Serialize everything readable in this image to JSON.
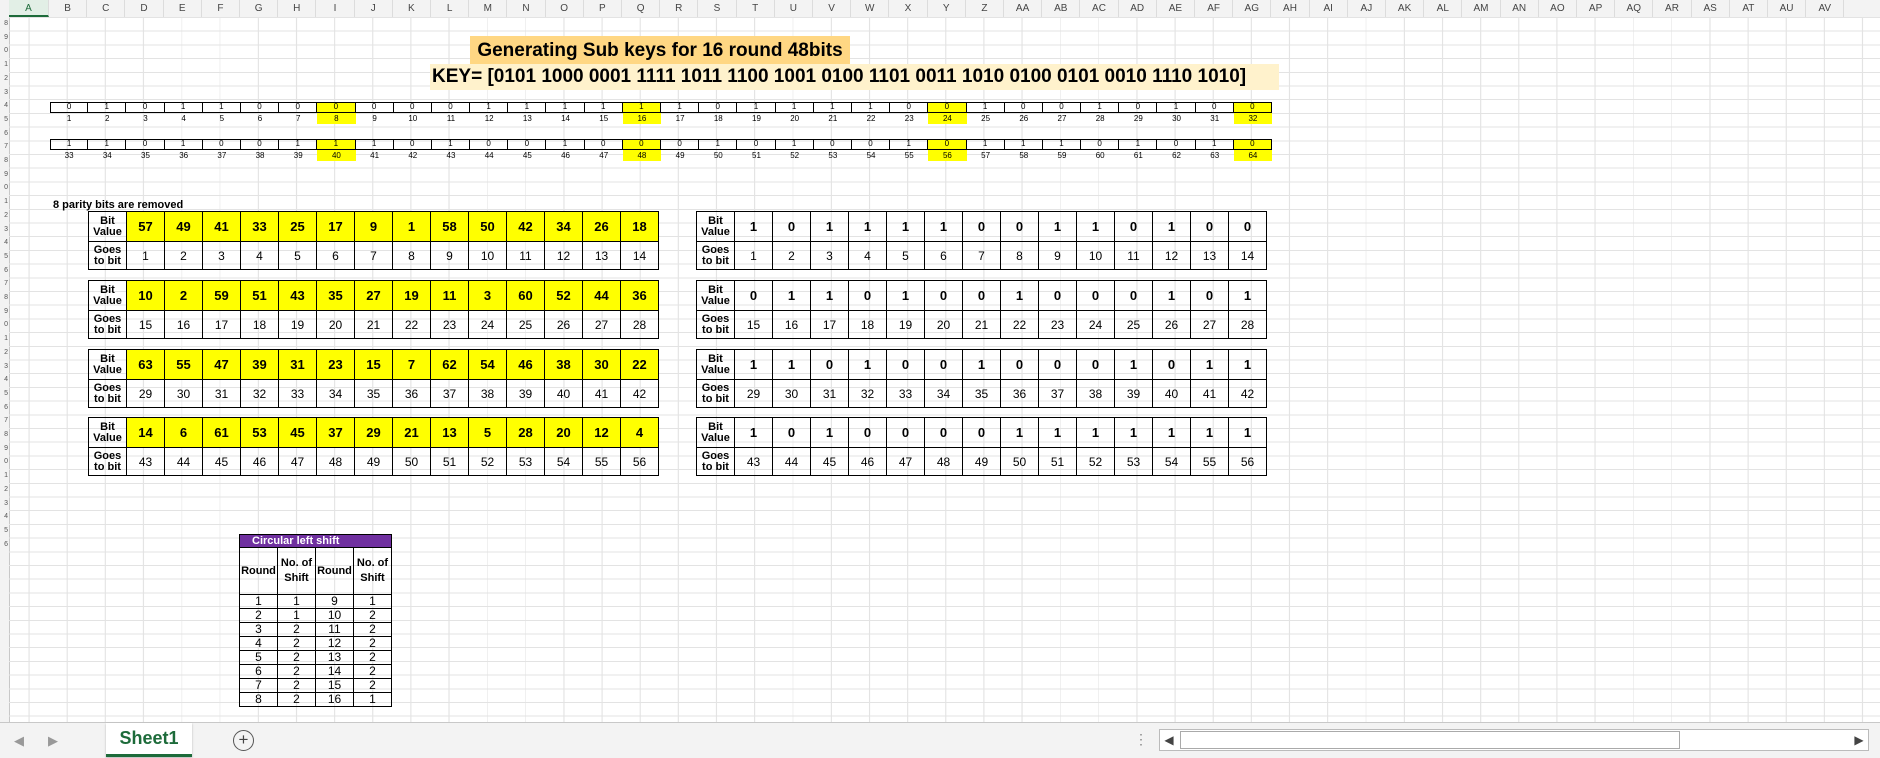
{
  "columns": [
    "A",
    "B",
    "C",
    "D",
    "E",
    "F",
    "G",
    "H",
    "I",
    "J",
    "K",
    "L",
    "M",
    "N",
    "O",
    "P",
    "Q",
    "R",
    "S",
    "T",
    "U",
    "V",
    "W",
    "X",
    "Y",
    "Z",
    "AA",
    "AB",
    "AC",
    "AD",
    "AE",
    "AF",
    "AG",
    "AH",
    "AI",
    "AJ",
    "AK",
    "AL",
    "AM",
    "AN",
    "AO",
    "AP",
    "AQ",
    "AR",
    "AS",
    "AT",
    "AU",
    "AV"
  ],
  "selected_column": "A",
  "row_numbers": [
    "8",
    "9",
    "0",
    "1",
    "2",
    "3",
    "4",
    "5",
    "6",
    "7",
    "8",
    "9",
    "0",
    "1",
    "2",
    "3",
    "4",
    "5",
    "6",
    "7",
    "8",
    "9",
    "0",
    "1",
    "2",
    "3",
    "4",
    "5",
    "6",
    "7",
    "8",
    "9",
    "0",
    "1",
    "2",
    "3",
    "4",
    "5",
    "6"
  ],
  "title": "Generating Sub keys for 16  round  48bits",
  "key_line": "KEY= [0101 1000 0001 1111 1011 1100 1001 0100 1101 0011 1010 0100 0101 0010 1110 1010]",
  "key_bits_row1": [
    "0",
    "1",
    "0",
    "1",
    "1",
    "0",
    "0",
    "0",
    "0",
    "0",
    "0",
    "1",
    "1",
    "1",
    "1",
    "1",
    "1",
    "0",
    "1",
    "1",
    "1",
    "1",
    "0",
    "0",
    "1",
    "0",
    "0",
    "1",
    "0",
    "1",
    "0",
    "0"
  ],
  "key_index_row1": [
    "1",
    "2",
    "3",
    "4",
    "5",
    "6",
    "7",
    "8",
    "9",
    "10",
    "11",
    "12",
    "13",
    "14",
    "15",
    "16",
    "17",
    "18",
    "19",
    "20",
    "21",
    "22",
    "23",
    "24",
    "25",
    "26",
    "27",
    "28",
    "29",
    "30",
    "31",
    "32"
  ],
  "key_bits_row2": [
    "1",
    "1",
    "0",
    "1",
    "0",
    "0",
    "1",
    "1",
    "1",
    "0",
    "1",
    "0",
    "0",
    "1",
    "0",
    "0",
    "0",
    "1",
    "0",
    "1",
    "0",
    "0",
    "1",
    "0",
    "1",
    "1",
    "1",
    "0",
    "1",
    "0",
    "1",
    "0"
  ],
  "key_index_row2": [
    "33",
    "34",
    "35",
    "36",
    "37",
    "38",
    "39",
    "40",
    "41",
    "42",
    "43",
    "44",
    "45",
    "46",
    "47",
    "48",
    "49",
    "50",
    "51",
    "52",
    "53",
    "54",
    "55",
    "56",
    "57",
    "58",
    "59",
    "60",
    "61",
    "62",
    "63",
    "64"
  ],
  "highlight_positions": [
    8,
    16,
    24,
    32
  ],
  "parity_note": "8 parity bits are removed",
  "label_bit_value": "Bit Value",
  "label_goes_to_bit": "Goes to bit",
  "pc1_tables": [
    {
      "values": [
        "57",
        "49",
        "41",
        "33",
        "25",
        "17",
        "9",
        "1",
        "58",
        "50",
        "42",
        "34",
        "26",
        "18"
      ],
      "goes": [
        "1",
        "2",
        "3",
        "4",
        "5",
        "6",
        "7",
        "8",
        "9",
        "10",
        "11",
        "12",
        "13",
        "14"
      ]
    },
    {
      "values": [
        "10",
        "2",
        "59",
        "51",
        "43",
        "35",
        "27",
        "19",
        "11",
        "3",
        "60",
        "52",
        "44",
        "36"
      ],
      "goes": [
        "15",
        "16",
        "17",
        "18",
        "19",
        "20",
        "21",
        "22",
        "23",
        "24",
        "25",
        "26",
        "27",
        "28"
      ]
    },
    {
      "values": [
        "63",
        "55",
        "47",
        "39",
        "31",
        "23",
        "15",
        "7",
        "62",
        "54",
        "46",
        "38",
        "30",
        "22"
      ],
      "goes": [
        "29",
        "30",
        "31",
        "32",
        "33",
        "34",
        "35",
        "36",
        "37",
        "38",
        "39",
        "40",
        "41",
        "42"
      ]
    },
    {
      "values": [
        "14",
        "6",
        "61",
        "53",
        "45",
        "37",
        "29",
        "21",
        "13",
        "5",
        "28",
        "20",
        "12",
        "4"
      ],
      "goes": [
        "43",
        "44",
        "45",
        "46",
        "47",
        "48",
        "49",
        "50",
        "51",
        "52",
        "53",
        "54",
        "55",
        "56"
      ]
    }
  ],
  "result_tables": [
    {
      "values": [
        "1",
        "0",
        "1",
        "1",
        "1",
        "1",
        "0",
        "0",
        "1",
        "1",
        "0",
        "1",
        "0",
        "0"
      ],
      "goes": [
        "1",
        "2",
        "3",
        "4",
        "5",
        "6",
        "7",
        "8",
        "9",
        "10",
        "11",
        "12",
        "13",
        "14"
      ]
    },
    {
      "values": [
        "0",
        "1",
        "1",
        "0",
        "1",
        "0",
        "0",
        "1",
        "0",
        "0",
        "0",
        "1",
        "0",
        "1"
      ],
      "goes": [
        "15",
        "16",
        "17",
        "18",
        "19",
        "20",
        "21",
        "22",
        "23",
        "24",
        "25",
        "26",
        "27",
        "28"
      ]
    },
    {
      "values": [
        "1",
        "1",
        "0",
        "1",
        "0",
        "0",
        "1",
        "0",
        "0",
        "0",
        "1",
        "0",
        "1",
        "1"
      ],
      "goes": [
        "29",
        "30",
        "31",
        "32",
        "33",
        "34",
        "35",
        "36",
        "37",
        "38",
        "39",
        "40",
        "41",
        "42"
      ]
    },
    {
      "values": [
        "1",
        "0",
        "1",
        "0",
        "0",
        "0",
        "0",
        "1",
        "1",
        "1",
        "1",
        "1",
        "1",
        "1"
      ],
      "goes": [
        "43",
        "44",
        "45",
        "46",
        "47",
        "48",
        "49",
        "50",
        "51",
        "52",
        "53",
        "54",
        "55",
        "56"
      ]
    }
  ],
  "shift_table": {
    "caption": "Circular left shift",
    "headers": [
      "Round",
      "No. of Shift",
      "Round",
      "No. of Shift"
    ],
    "rows": [
      [
        "1",
        "1",
        "9",
        "1"
      ],
      [
        "2",
        "1",
        "10",
        "2"
      ],
      [
        "3",
        "2",
        "11",
        "2"
      ],
      [
        "4",
        "2",
        "12",
        "2"
      ],
      [
        "5",
        "2",
        "13",
        "2"
      ],
      [
        "6",
        "2",
        "14",
        "2"
      ],
      [
        "7",
        "2",
        "15",
        "2"
      ],
      [
        "8",
        "2",
        "16",
        "1"
      ]
    ]
  },
  "sheet_tab": "Sheet1",
  "add_sheet_icon": "plus-circle-icon",
  "colors": {
    "title_bg": "#ffd783",
    "key_bg": "#fff2cc",
    "highlight": "#ffff00",
    "shift_caption": "#7030a0",
    "tab_accent": "#1d6b3a"
  }
}
